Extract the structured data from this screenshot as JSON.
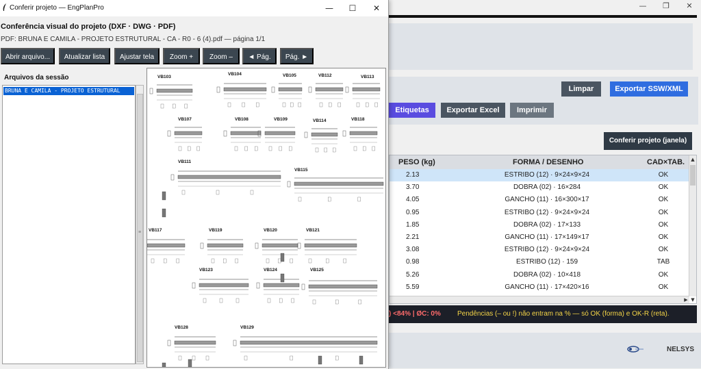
{
  "main_window": {
    "window_controls": {
      "minimize": "—",
      "maximize": "❐",
      "close": "✕"
    },
    "buttons": {
      "limpar": "Limpar",
      "exportar_ssw": "Exportar SSW/XML",
      "etiquetas": "Etiquetas",
      "exportar_excel": "Exportar Excel",
      "imprimir": "Imprimir",
      "conferir_janela": "Conferir projeto (janela)"
    },
    "table": {
      "headers": [
        "PESO (kg)",
        "FORMA / DESENHO",
        "CAD×TAB."
      ],
      "rows": [
        {
          "peso": "2.13",
          "forma": "ESTRIBO (12) · 9×24×9×24",
          "status": "OK"
        },
        {
          "peso": "3.70",
          "forma": "DOBRA (02) · 16×284",
          "status": "OK"
        },
        {
          "peso": "4.05",
          "forma": "GANCHO (11) · 16×300×17",
          "status": "OK"
        },
        {
          "peso": "0.95",
          "forma": "ESTRIBO (12) · 9×24×9×24",
          "status": "OK"
        },
        {
          "peso": "1.85",
          "forma": "DOBRA (02) · 17×133",
          "status": "OK"
        },
        {
          "peso": "2.21",
          "forma": "GANCHO (11) · 17×149×17",
          "status": "OK"
        },
        {
          "peso": "3.08",
          "forma": "ESTRIBO (12) · 9×24×9×24",
          "status": "OK"
        },
        {
          "peso": "0.98",
          "forma": "ESTRIBO (12) · 159",
          "status": "TAB"
        },
        {
          "peso": "5.26",
          "forma": "DOBRA (02) · 10×418",
          "status": "OK"
        },
        {
          "peso": "5.59",
          "forma": "GANCHO (11) · 17×420×16",
          "status": "OK"
        }
      ],
      "selected_row": 0
    },
    "status": {
      "left": ") <84% | ØC: 0%",
      "right": "Pendências (– ou !) não entram na % — só OK (forma) e OK-R (reta)."
    },
    "footer_brand": "NELSYS"
  },
  "dialog": {
    "title": "Conferir projeto — EngPlanPro",
    "window_controls": {
      "minimize": "—",
      "maximize": "☐",
      "close": "✕"
    },
    "heading": "Conferência visual do projeto (DXF · DWG · PDF)",
    "pdf_info": "PDF: BRUNA E CAMILA - PROJETO ESTRUTURAL - CA - R0 - 6 (4).pdf — página 1/1",
    "toolbar": [
      "Abrir arquivo...",
      "Atualizar lista",
      "Ajustar tela",
      "Zoom +",
      "Zoom –",
      "◄ Pág.",
      "Pág. ►"
    ],
    "session_label": "Arquivos da sessão",
    "session_files": [
      "BRUNA E CAMILA - PROJETO ESTRUTURAL"
    ],
    "drawing_labels": [
      "VB103",
      "VB104",
      "VB105",
      "VB112",
      "VB113",
      "VB107",
      "VB108",
      "VB109",
      "VB114",
      "VB118",
      "VB111",
      "VB115",
      "VB117",
      "VB119",
      "VB120",
      "VB121",
      "VB123",
      "VB124",
      "VB125",
      "VB128",
      "VB129"
    ]
  }
}
